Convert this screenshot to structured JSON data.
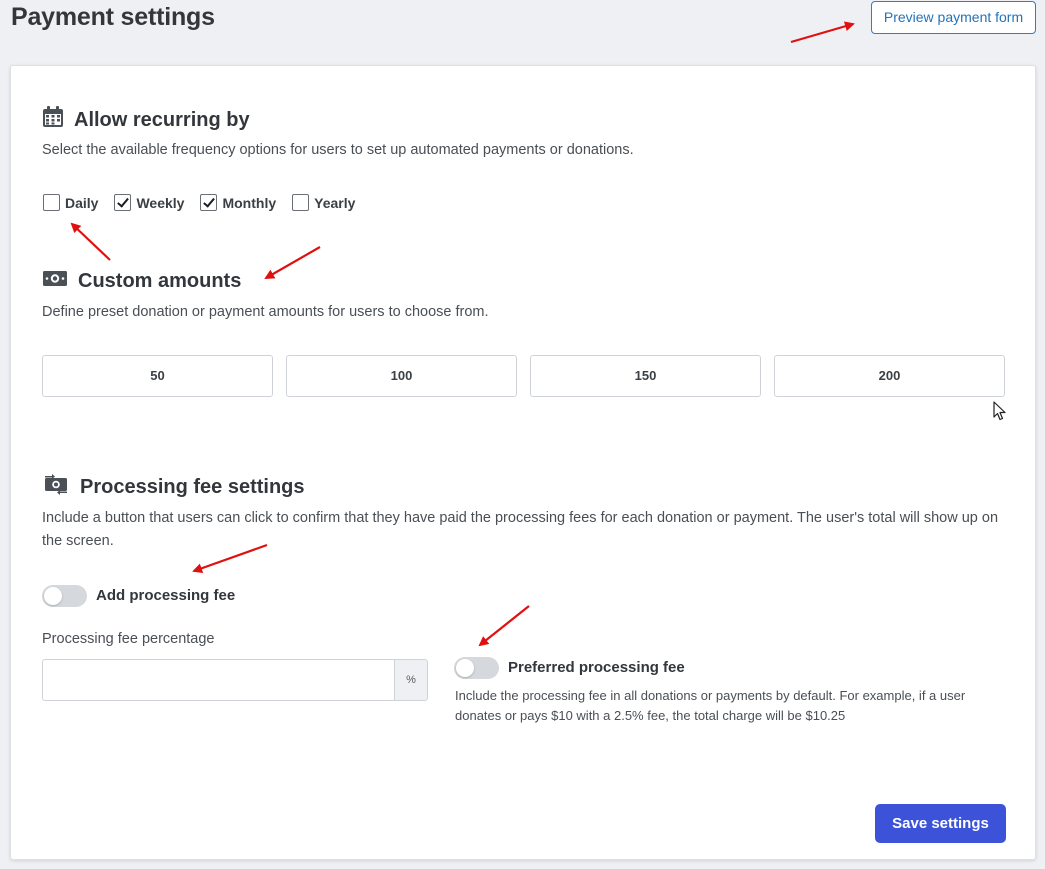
{
  "page": {
    "title": "Payment settings",
    "preview_button": "Preview payment form"
  },
  "recurring": {
    "title": "Allow recurring by",
    "description": "Select the available frequency options for users to set up automated payments or donations.",
    "options": [
      {
        "label": "Daily",
        "checked": false
      },
      {
        "label": "Weekly",
        "checked": true
      },
      {
        "label": "Monthly",
        "checked": true
      },
      {
        "label": "Yearly",
        "checked": false
      }
    ]
  },
  "custom_amounts": {
    "title": "Custom amounts",
    "description": "Define preset donation or payment amounts for users to choose from.",
    "values": [
      "50",
      "100",
      "150",
      "200"
    ]
  },
  "processing_fee": {
    "title": "Processing fee settings",
    "description": "Include a button that users can click to confirm that they have paid the processing fees for each donation or payment. The user's total will show up on the screen.",
    "add_fee_label": "Add processing fee",
    "add_fee_enabled": false,
    "percentage_label": "Processing fee percentage",
    "percentage_value": "",
    "percentage_unit": "%",
    "preferred_label": "Preferred processing fee",
    "preferred_enabled": false,
    "preferred_description": "Include the processing fee in all donations or payments by default. For example, if a user donates or pays $10 with a 2.5% fee, the total charge will be $10.25"
  },
  "actions": {
    "save_label": "Save settings"
  },
  "colors": {
    "accent": "#3b52d9",
    "link": "#2373b8",
    "annotation_arrow": "#e11010",
    "background": "#eef0f4"
  }
}
